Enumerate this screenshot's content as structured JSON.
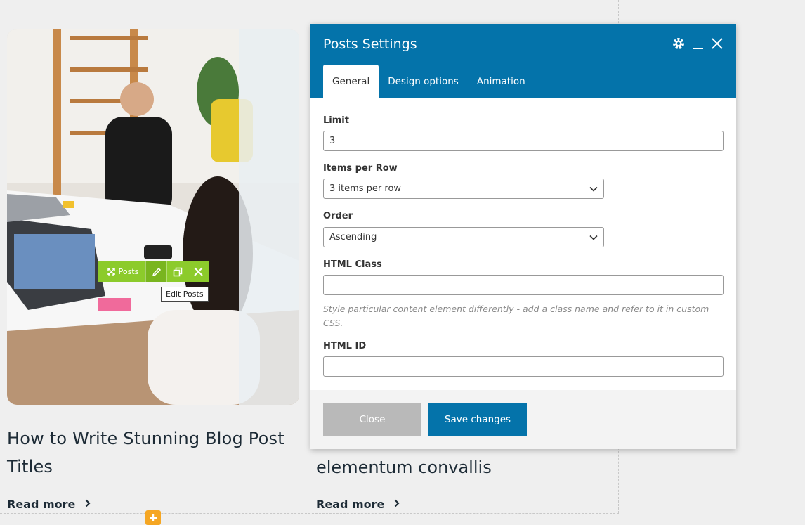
{
  "posts": [
    {
      "title": "How to Write Stunning Blog Post Titles",
      "read_more": "Read more"
    },
    {
      "title": "elementum convallis",
      "read_more": "Read more"
    }
  ],
  "element_toolbar": {
    "label": "Posts",
    "tooltip": "Edit Posts",
    "color": "#8ccb2b"
  },
  "panel": {
    "title": "Posts Settings",
    "header_color": "#0473aa",
    "tabs": [
      {
        "label": "General",
        "active": true
      },
      {
        "label": "Design options",
        "active": false
      },
      {
        "label": "Animation",
        "active": false
      }
    ],
    "fields": {
      "limit": {
        "label": "Limit",
        "value": "3"
      },
      "items_per_row": {
        "label": "Items per Row",
        "value": "3 items per row"
      },
      "order": {
        "label": "Order",
        "value": "Ascending"
      },
      "html_class": {
        "label": "HTML Class",
        "value": "",
        "help": "Style particular content element differently - add a class name and refer to it in custom CSS."
      },
      "html_id": {
        "label": "HTML ID",
        "value": ""
      }
    },
    "buttons": {
      "close": "Close",
      "save": "Save changes"
    }
  }
}
